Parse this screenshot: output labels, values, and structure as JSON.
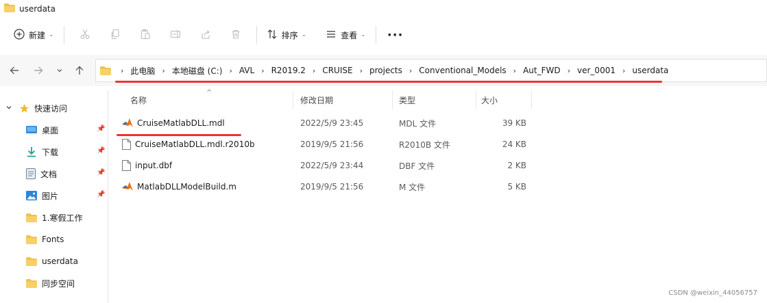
{
  "window": {
    "title": "userdata"
  },
  "toolbar": {
    "new_label": "新建",
    "sort_label": "排序",
    "view_label": "查看",
    "more_label": "···",
    "icons": [
      "cut-icon",
      "copy-icon",
      "paste-icon",
      "rename-icon",
      "share-icon",
      "delete-icon"
    ]
  },
  "address": {
    "crumbs": [
      "此电脑",
      "本地磁盘 (C:)",
      "AVL",
      "R2019.2",
      "CRUISE",
      "projects",
      "Conventional_Models",
      "Aut_FWD",
      "ver_0001",
      "userdata"
    ]
  },
  "sidebar": {
    "quick_access": "快速访问",
    "items": [
      {
        "label": "桌面",
        "icon": "desktop-icon",
        "pinned": true
      },
      {
        "label": "下载",
        "icon": "download-icon",
        "pinned": true
      },
      {
        "label": "文档",
        "icon": "document-icon",
        "pinned": true
      },
      {
        "label": "图片",
        "icon": "picture-icon",
        "pinned": true
      },
      {
        "label": "1.寒假工作",
        "icon": "folder-icon",
        "pinned": false
      },
      {
        "label": "Fonts",
        "icon": "folder-icon",
        "pinned": false
      },
      {
        "label": "userdata",
        "icon": "folder-icon",
        "pinned": false
      },
      {
        "label": "同步空间",
        "icon": "folder-icon",
        "pinned": false
      }
    ]
  },
  "columns": {
    "name": "名称",
    "date": "修改日期",
    "type": "类型",
    "size": "大小"
  },
  "files": [
    {
      "name": "CruiseMatlabDLL.mdl",
      "date": "2022/5/9 23:45",
      "type": "MDL 文件",
      "size": "39 KB",
      "icon": "matlab-icon"
    },
    {
      "name": "CruiseMatlabDLL.mdl.r2010b",
      "date": "2019/9/5 21:56",
      "type": "R2010B 文件",
      "size": "24 KB",
      "icon": "file-icon"
    },
    {
      "name": "input.dbf",
      "date": "2022/5/9 23:44",
      "type": "DBF 文件",
      "size": "2 KB",
      "icon": "file-icon"
    },
    {
      "name": "MatlabDLLModelBuild.m",
      "date": "2019/9/5 21:56",
      "type": "M 文件",
      "size": "5 KB",
      "icon": "matlab-icon"
    }
  ],
  "watermark": "CSDN @weixin_44056757",
  "colors": {
    "folder": "#f2c14e",
    "annotation": "#e33333",
    "matlab": "#e8731b"
  }
}
